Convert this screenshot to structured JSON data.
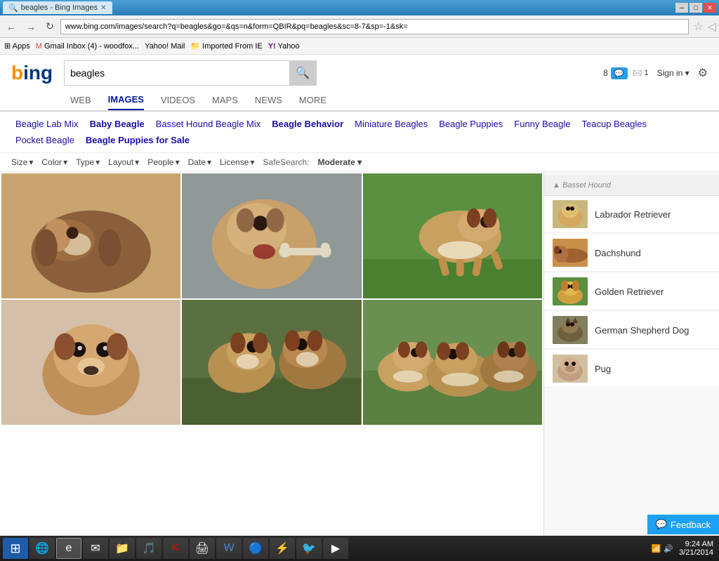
{
  "titlebar": {
    "tab_title": "beagles - Bing Images",
    "url": "www.bing.com/images/search?q=beagles&go=&qs=n&form=QBIR&pq=beagles&sc=8-7&sp=-1&sk="
  },
  "bookmarks": {
    "items": [
      {
        "label": "Apps"
      },
      {
        "label": "Gmail Inbox (4) - woodfox..."
      },
      {
        "label": "Yahoo! Mail"
      },
      {
        "label": "Imported From IE"
      },
      {
        "label": "Yahoo"
      }
    ]
  },
  "search": {
    "query": "beagles",
    "placeholder": "Search"
  },
  "header": {
    "notifications": "8",
    "inbox_count": "1",
    "signin_label": "Sign in",
    "settings_label": "⚙"
  },
  "nav_tabs": [
    {
      "label": "WEB",
      "active": false
    },
    {
      "label": "IMAGES",
      "active": true
    },
    {
      "label": "VIDEOS",
      "active": false
    },
    {
      "label": "MAPS",
      "active": false
    },
    {
      "label": "NEWS",
      "active": false
    },
    {
      "label": "MORE",
      "active": false
    }
  ],
  "suggestions": [
    {
      "label": "Beagle Lab Mix",
      "bold": false
    },
    {
      "label": "Baby Beagle",
      "bold": true
    },
    {
      "label": "Basset Hound Beagle Mix",
      "bold": false
    },
    {
      "label": "Beagle Behavior",
      "bold": true
    },
    {
      "label": "Miniature Beagles",
      "bold": false
    },
    {
      "label": "Beagle Puppies",
      "bold": false
    },
    {
      "label": "Funny Beagle",
      "bold": false
    },
    {
      "label": "Teacup Beagles",
      "bold": false
    },
    {
      "label": "Pocket Beagle",
      "bold": false
    },
    {
      "label": "Beagle Puppies for Sale",
      "bold": true
    }
  ],
  "filters": {
    "size_label": "Size",
    "color_label": "Color",
    "type_label": "Type",
    "layout_label": "Layout",
    "people_label": "People",
    "date_label": "Date",
    "license_label": "License",
    "safesearch_label": "SafeSearch:",
    "safesearch_value": "Moderate"
  },
  "sidebar": {
    "items": [
      {
        "label": "Basset Hound",
        "thumb_class": "thumb-basset"
      },
      {
        "label": "Labrador Retriever",
        "thumb_class": "thumb-labrador"
      },
      {
        "label": "Dachshund",
        "thumb_class": "thumb-dachshund"
      },
      {
        "label": "Golden Retriever",
        "thumb_class": "thumb-golden"
      },
      {
        "label": "German Shepherd Dog",
        "thumb_class": "thumb-german"
      },
      {
        "label": "Pug",
        "thumb_class": "thumb-pug"
      }
    ]
  },
  "feedback": {
    "label": "Feedback"
  },
  "taskbar": {
    "time": "9:24 AM",
    "date": "3/21/2014"
  }
}
